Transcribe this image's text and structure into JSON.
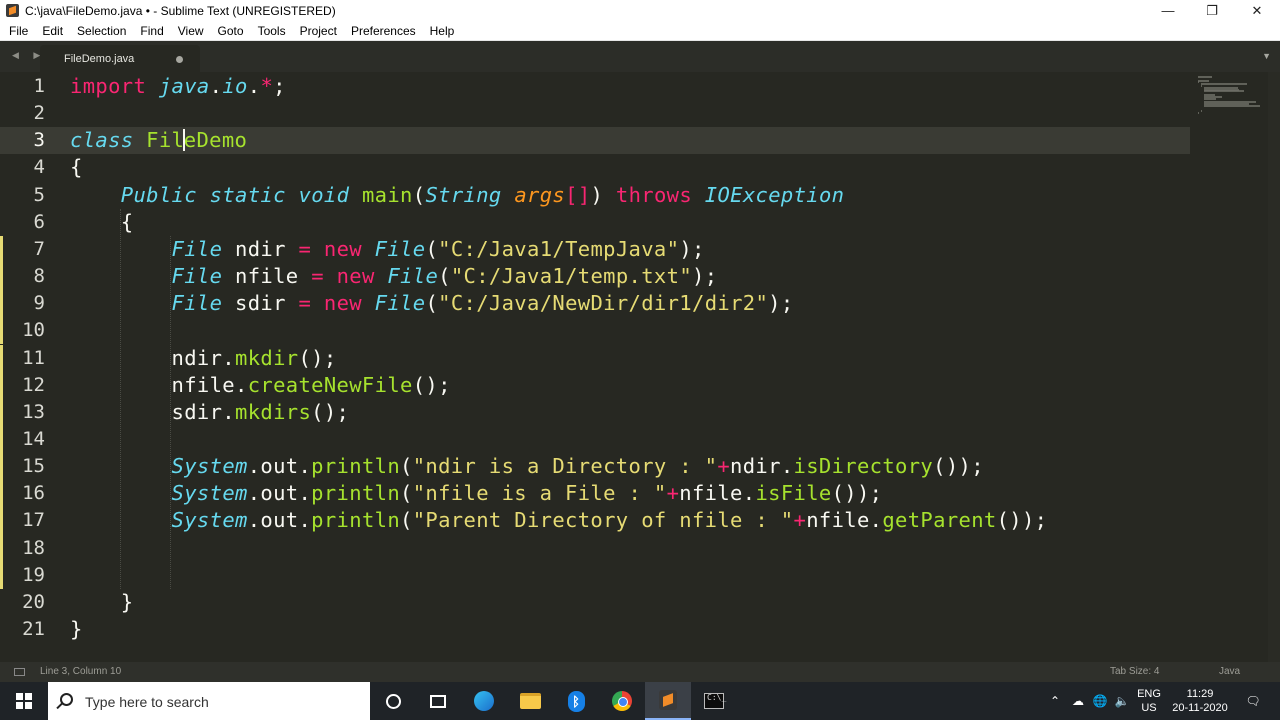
{
  "window": {
    "title": "C:\\java\\FileDemo.java • - Sublime Text (UNREGISTERED)",
    "controls": {
      "minimize": "—",
      "maximize": "❐",
      "close": "✕"
    }
  },
  "menu": [
    "File",
    "Edit",
    "Selection",
    "Find",
    "View",
    "Goto",
    "Tools",
    "Project",
    "Preferences",
    "Help"
  ],
  "tab": {
    "label": "FileDemo.java",
    "nav_arrows": "◀ ▶",
    "dropdown": "▼"
  },
  "editor": {
    "active_line": 3,
    "line_numbers": [
      "1",
      "2",
      "3",
      "4",
      "5",
      "6",
      "7",
      "8",
      "9",
      "10",
      "11",
      "12",
      "13",
      "14",
      "15",
      "16",
      "17",
      "18",
      "19",
      "20",
      "21"
    ],
    "modified_lines": [
      7,
      8,
      9,
      10,
      11,
      12,
      13,
      14,
      15,
      16,
      17,
      18,
      19
    ],
    "lines": [
      "import java.io.*;",
      "",
      "class FileDemo",
      "{",
      "    Public static void main(String args[]) throws IOException",
      "    {",
      "        File ndir = new File(\"C:/Java1/TempJava\");",
      "        File nfile = new File(\"C:/Java1/temp.txt\");",
      "        File sdir = new File(\"C:/Java/NewDir/dir1/dir2\");",
      "",
      "        ndir.mkdir();",
      "        nfile.createNewFile();",
      "        sdir.mkdirs();",
      "",
      "        System.out.println(\"ndir is a Directory : \"+ndir.isDirectory());",
      "        System.out.println(\"nfile is a File : \"+nfile.isFile());",
      "        System.out.println(\"Parent Directory of nfile : \"+nfile.getParent());",
      "",
      "",
      "    }",
      "}"
    ]
  },
  "status": {
    "position": "Line 3, Column 10",
    "tab_size": "Tab Size: 4",
    "syntax": "Java"
  },
  "taskbar": {
    "search_placeholder": "Type here to search",
    "apps": [
      "cortana",
      "task-view",
      "edge",
      "file-explorer",
      "bluetooth",
      "chrome",
      "sublime-text",
      "command-prompt"
    ],
    "language": "ENG",
    "region": "US",
    "time": "11:29",
    "date": "20-11-2020"
  }
}
